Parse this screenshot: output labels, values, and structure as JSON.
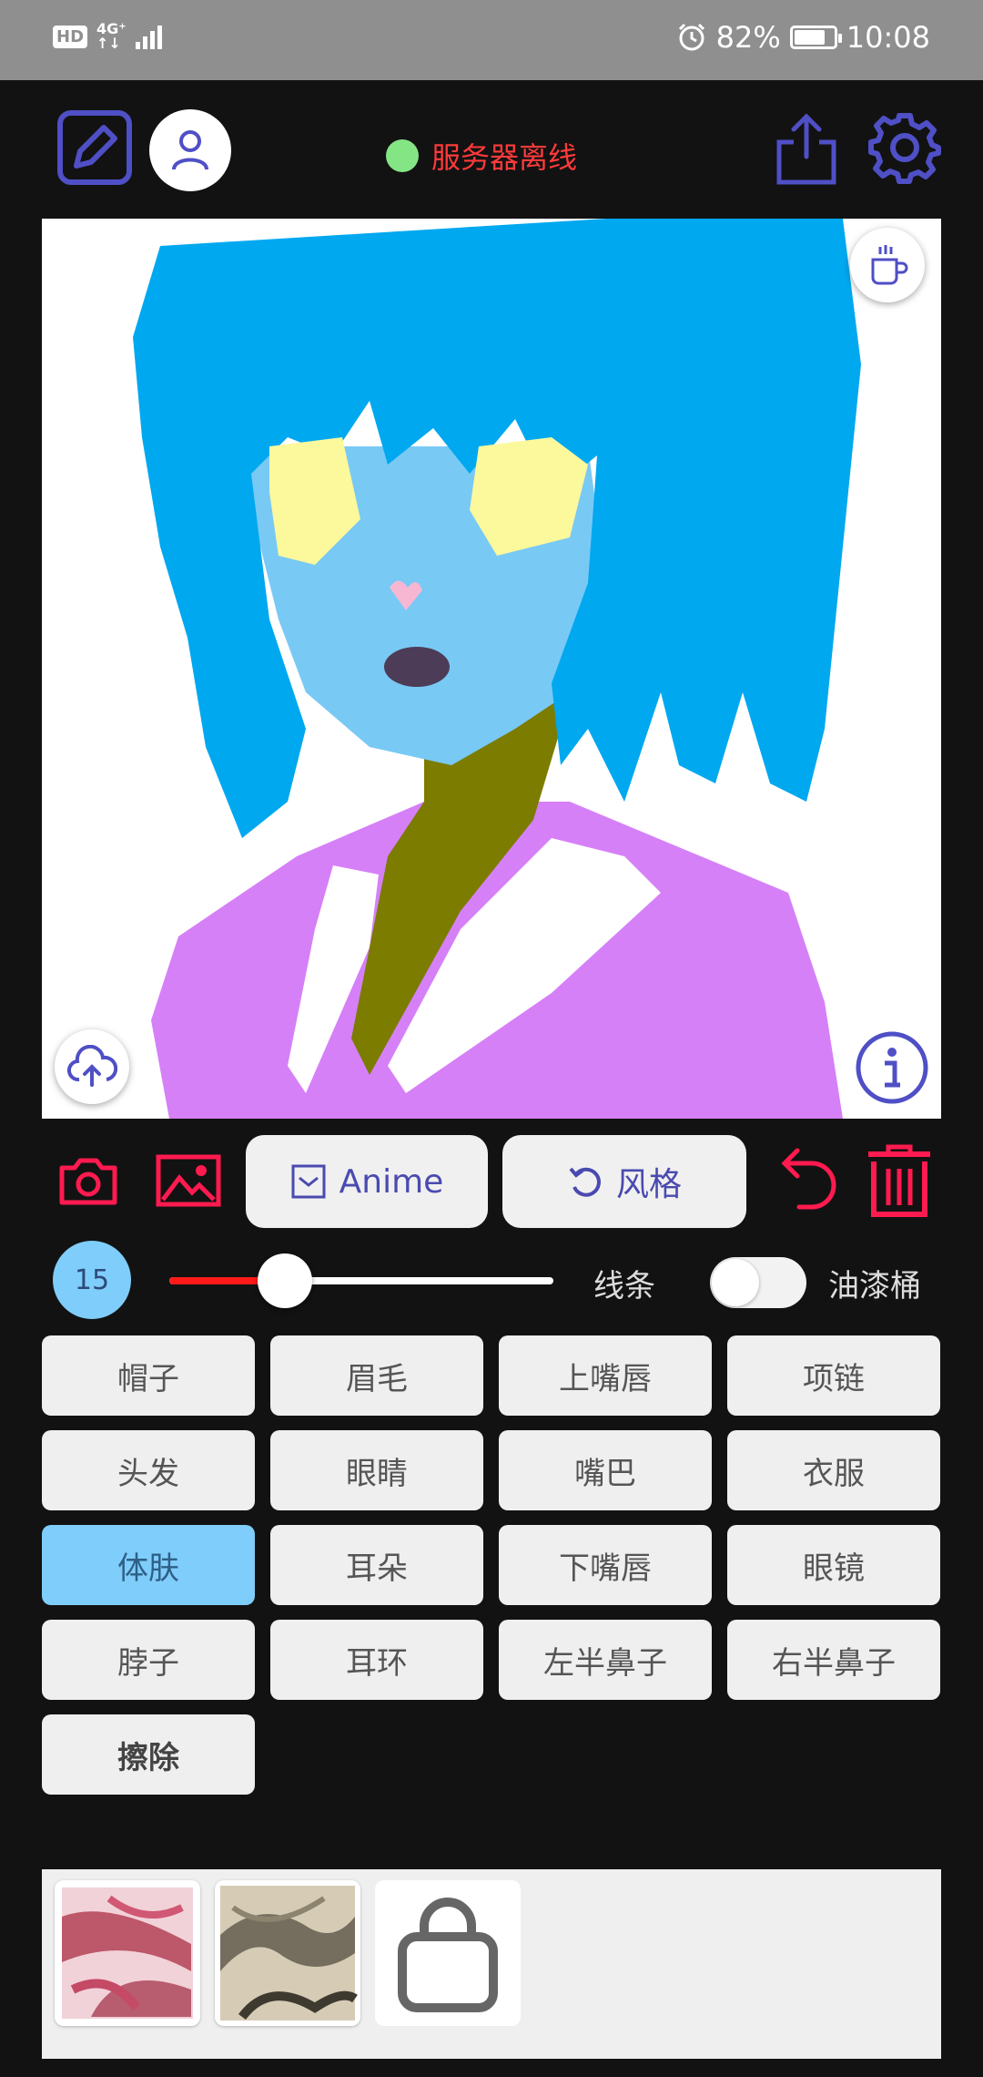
{
  "status_bar": {
    "hd": "HD",
    "network": "4G⁺",
    "network_sub": "↑↓",
    "battery": "82%",
    "battery_level": 0.82,
    "time": "10:08"
  },
  "header": {
    "server_status": "服务器离线",
    "server_status_color": "#84e584",
    "accent": "#4f4fc6"
  },
  "actions": {
    "anime_label": "Anime",
    "style_label": "风格"
  },
  "brush": {
    "size": "15",
    "slider_level": 0.3,
    "line_label": "线条",
    "bucket_label": "油漆桶",
    "bucket_on": false
  },
  "parts": [
    {
      "label": "帽子",
      "active": false
    },
    {
      "label": "眉毛",
      "active": false
    },
    {
      "label": "上嘴唇",
      "active": false
    },
    {
      "label": "项链",
      "active": false
    },
    {
      "label": "头发",
      "active": false
    },
    {
      "label": "眼睛",
      "active": false
    },
    {
      "label": "嘴巴",
      "active": false
    },
    {
      "label": "衣服",
      "active": false
    },
    {
      "label": "体肤",
      "active": true
    },
    {
      "label": "耳朵",
      "active": false
    },
    {
      "label": "下嘴唇",
      "active": false
    },
    {
      "label": "眼镜",
      "active": false
    },
    {
      "label": "脖子",
      "active": false
    },
    {
      "label": "耳环",
      "active": false
    },
    {
      "label": "左半鼻子",
      "active": false
    },
    {
      "label": "右半鼻子",
      "active": false
    },
    {
      "label": "擦除",
      "active": false
    }
  ],
  "colors": {
    "hair": "#00a8f0",
    "skin": "#79c9f5",
    "eyes": "#fcf89c",
    "neck": "#7c7c00",
    "clothes": "#d680f8",
    "red_accent": "#ff1a4f"
  }
}
